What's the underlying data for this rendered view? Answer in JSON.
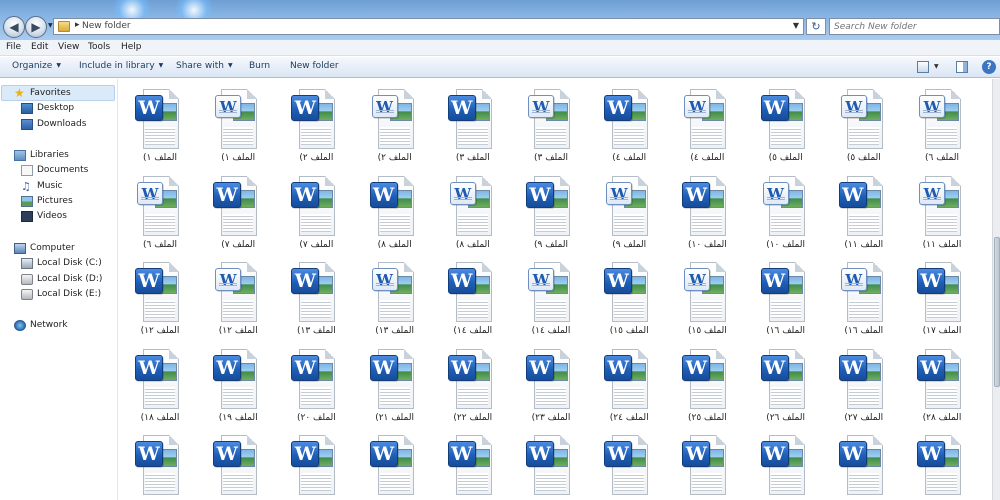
{
  "window": {
    "address_crumb": "New folder",
    "search_placeholder": "Search New folder"
  },
  "menu": [
    "File",
    "Edit",
    "View",
    "Tools",
    "Help"
  ],
  "command_bar": {
    "organize": "Organize",
    "include_in_library": "Include in library",
    "share_with": "Share with",
    "burn": "Burn",
    "new_folder": "New folder"
  },
  "nav_pane": {
    "favorites": "Favorites",
    "desktop": "Desktop",
    "downloads": "Downloads",
    "libraries": "Libraries",
    "documents": "Documents",
    "music": "Music",
    "pictures": "Pictures",
    "videos": "Videos",
    "computer": "Computer",
    "disk_c": "Local Disk (C:)",
    "disk_d": "Local Disk (D:)",
    "disk_e": "Local Disk (E:)",
    "network": "Network"
  },
  "files": [
    {
      "name": "الملف ١)",
      "style": "word"
    },
    {
      "name": "الملف ١)",
      "style": "doc"
    },
    {
      "name": "الملف ٢)",
      "style": "word"
    },
    {
      "name": "الملف ٢)",
      "style": "doc"
    },
    {
      "name": "الملف ٣)",
      "style": "word"
    },
    {
      "name": "الملف ٣)",
      "style": "doc"
    },
    {
      "name": "الملف ٤)",
      "style": "word"
    },
    {
      "name": "الملف ٤)",
      "style": "doc"
    },
    {
      "name": "الملف ٥)",
      "style": "word"
    },
    {
      "name": "الملف ٥)",
      "style": "doc"
    },
    {
      "name": "الملف ٦)",
      "style": "doc"
    },
    {
      "name": "الملف ٦)",
      "style": "doc"
    },
    {
      "name": "الملف ٧)",
      "style": "word"
    },
    {
      "name": "الملف ٧)",
      "style": "word"
    },
    {
      "name": "الملف ٨)",
      "style": "word"
    },
    {
      "name": "الملف ٨)",
      "style": "doc"
    },
    {
      "name": "الملف ٩)",
      "style": "word"
    },
    {
      "name": "الملف ٩)",
      "style": "doc"
    },
    {
      "name": "الملف ١٠)",
      "style": "word"
    },
    {
      "name": "الملف ١٠)",
      "style": "doc"
    },
    {
      "name": "الملف ١١)",
      "style": "word"
    },
    {
      "name": "الملف ١١)",
      "style": "doc"
    },
    {
      "name": "الملف ١٢)",
      "style": "word"
    },
    {
      "name": "الملف ١٢)",
      "style": "doc"
    },
    {
      "name": "الملف ١٣)",
      "style": "word"
    },
    {
      "name": "الملف ١٣)",
      "style": "doc"
    },
    {
      "name": "الملف ١٤)",
      "style": "word"
    },
    {
      "name": "الملف ١٤)",
      "style": "doc"
    },
    {
      "name": "الملف ١٥)",
      "style": "word"
    },
    {
      "name": "الملف ١٥)",
      "style": "doc"
    },
    {
      "name": "الملف ١٦)",
      "style": "word"
    },
    {
      "name": "الملف ١٦)",
      "style": "doc"
    },
    {
      "name": "الملف ١٧)",
      "style": "word"
    },
    {
      "name": "الملف ١٨)",
      "style": "word"
    },
    {
      "name": "الملف ١٩)",
      "style": "word"
    },
    {
      "name": "الملف ٢٠)",
      "style": "word"
    },
    {
      "name": "الملف ٢١)",
      "style": "word"
    },
    {
      "name": "الملف ٢٢)",
      "style": "word"
    },
    {
      "name": "الملف ٢٣)",
      "style": "word"
    },
    {
      "name": "الملف ٢٤)",
      "style": "word"
    },
    {
      "name": "الملف ٢٥)",
      "style": "word"
    },
    {
      "name": "الملف ٢٦)",
      "style": "word"
    },
    {
      "name": "الملف ٢٧)",
      "style": "word"
    },
    {
      "name": "الملف ٢٨)",
      "style": "word"
    },
    {
      "name": "",
      "style": "word"
    },
    {
      "name": "",
      "style": "word"
    },
    {
      "name": "",
      "style": "word"
    },
    {
      "name": "",
      "style": "word"
    },
    {
      "name": "",
      "style": "word"
    },
    {
      "name": "",
      "style": "word"
    },
    {
      "name": "",
      "style": "word"
    },
    {
      "name": "",
      "style": "word"
    },
    {
      "name": "",
      "style": "word"
    },
    {
      "name": "",
      "style": "word"
    },
    {
      "name": "",
      "style": "word"
    }
  ],
  "icons": {
    "back": "back-arrow-icon",
    "forward": "forward-arrow-icon",
    "refresh": "refresh-icon",
    "word_file": "word-document-icon"
  }
}
